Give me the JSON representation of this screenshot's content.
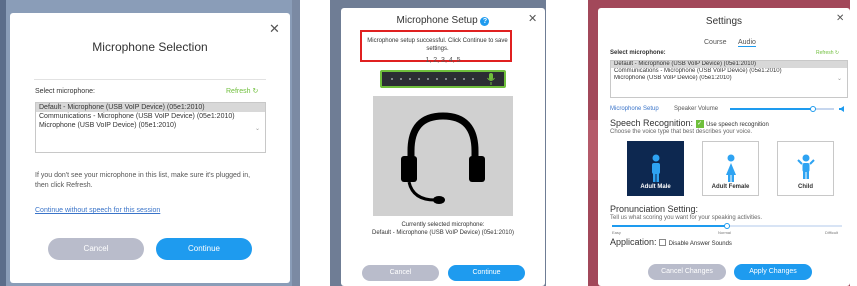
{
  "dialog1": {
    "title": "Microphone Selection",
    "select_label": "Select microphone:",
    "refresh_label": "Refresh",
    "options": [
      "Default - Microphone (USB VoIP Device) (05e1:2010)",
      "Communications - Microphone (USB VoIP Device) (05e1:2010)",
      "Microphone (USB VoIP Device) (05e1:2010)"
    ],
    "selected_index": 0,
    "help_text": "If you don't see your microphone in this list, make sure it's plugged in, then click Refresh.",
    "continue_link": "Continue without speech for this session",
    "cancel_label": "Cancel",
    "continue_label": "Continue"
  },
  "dialog2": {
    "title": "Microphone Setup",
    "success_text": "Microphone setup successful. Click Continue to save settings.",
    "count_text": "1, 2, 3, 4, 5",
    "current_label": "Currently selected microphone:",
    "current_device": "Default - Microphone (USB VoIP Device) (05e1:2010)",
    "cancel_label": "Cancel",
    "continue_label": "Continue"
  },
  "dialog3": {
    "title": "Settings",
    "tabs": [
      {
        "label": "Course",
        "active": false
      },
      {
        "label": "Audio",
        "active": true
      }
    ],
    "select_label": "Select microphone:",
    "refresh_label": "Refresh",
    "options": [
      "Default - Microphone (USB VoIP Device) (05e1:2010)",
      "Communications - Microphone (USB VoIP Device) (05e1:2010)",
      "Microphone (USB VoIP Device) (05e1:2010)"
    ],
    "mic_setup_link": "Microphone Setup",
    "speaker_volume_label": "Speaker Volume",
    "speaker_volume_level": 0.8,
    "speech_heading": "Speech Recognition:",
    "speech_checkbox_label": "Use speech recognition",
    "speech_checked": true,
    "voice_prompt": "Choose the voice type that best describes your voice.",
    "voices": [
      {
        "label": "Adult Male",
        "icon": "male-icon",
        "selected": true
      },
      {
        "label": "Adult Female",
        "icon": "female-icon",
        "selected": false
      },
      {
        "label": "Child",
        "icon": "child-icon",
        "selected": false
      }
    ],
    "pron_heading": "Pronunciation Setting:",
    "pron_desc": "Tell us what scoring you want for your speaking activities.",
    "pron_levels": [
      "Easy",
      "Normal",
      "Difficult"
    ],
    "pron_level_value": 0.5,
    "app_heading": "Application:",
    "app_checkbox_label": "Disable Answer Sounds",
    "app_checked": false,
    "cancel_label": "Cancel Changes",
    "apply_label": "Apply Changes"
  },
  "colors": {
    "accent": "#1e9bef",
    "success_green": "#6fbf3c",
    "highlight_red": "#e02020",
    "selected_tile": "#0d2850"
  }
}
